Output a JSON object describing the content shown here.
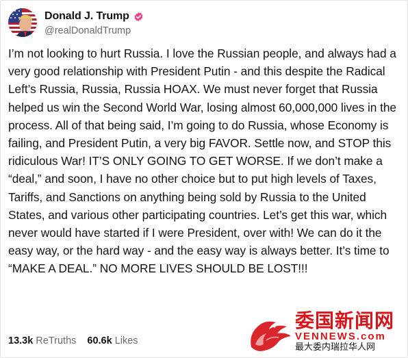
{
  "post": {
    "author": {
      "display_name": "Donald J. Trump",
      "handle": "@realDonaldTrump",
      "verified": true,
      "avatar_icon": "avatar-flag-portrait"
    },
    "text": "I’m not looking to hurt Russia. I love the Russian people, and always had a very good relationship with President Putin - and this despite the Radical Left’s Russia, Russia, Russia HOAX. We must never forget that Russia helped us win the Second World War, losing almost 60,000,000 lives in the process. All of that being said, I’m going to do Russia, whose Economy is failing, and President Putin, a very big FAVOR. Settle now, and STOP this ridiculous War! IT’S ONLY GOING TO GET WORSE. If we don’t make a “deal,” and soon, I have no other choice but to put high levels of Taxes, Tariffs, and Sanctions on anything being sold by Russia to the United States, and various other participating countries. Let’s get this war, which never would have started if I were President, over with! We can do it the easy way, or the hard way - and the easy way is always better. It’s time to “MAKE A DEAL.” NO MORE LIVES SHOULD BE LOST!!!",
    "stats": {
      "retruths_count": "13.3k",
      "retruths_label": "ReTruths",
      "likes_count": "60.6k",
      "likes_label": "Likes"
    }
  },
  "watermark": {
    "logo_text": "委国新闻网",
    "site": "VENNEWS.com",
    "tagline": "最大委内瑞拉华人网"
  },
  "colors": {
    "verified_badge": "#e8458b",
    "watermark_red": "#d6141a",
    "text": "#141414",
    "muted": "#6b6b6b"
  }
}
